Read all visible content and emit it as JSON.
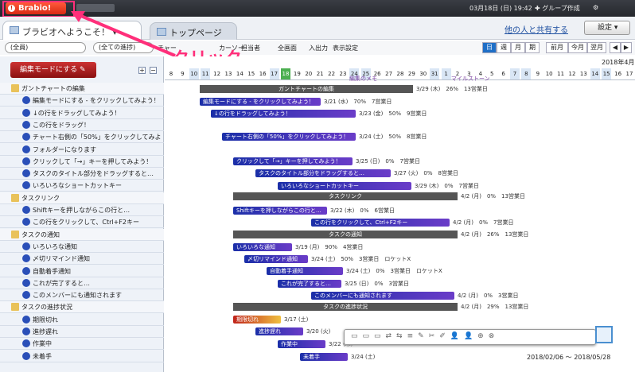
{
  "topbar": {
    "logo": "Brabio!",
    "date": "03月18日 (日) 19:42",
    "group": "グループ作成",
    "gear": "⚙"
  },
  "tabs": {
    "project": "ブラビオへようこそ！",
    "top": "トップページ"
  },
  "share": "他の人と共有する",
  "settings": "設定",
  "filters": {
    "member": "(全員)",
    "progress": "(全ての進捗)"
  },
  "toolbar": [
    "チャー",
    "カーソー",
    "担当者",
    "全画面",
    "入出力",
    "表示設定"
  ],
  "views": [
    "日",
    "週",
    "月",
    "期"
  ],
  "nav": [
    "前月",
    "今月",
    "翌月"
  ],
  "callout": "クリック",
  "edit_button": "編集モードにする",
  "month": "2018年4月",
  "days": [
    "8",
    "9",
    "10",
    "11",
    "12",
    "13",
    "14",
    "15",
    "16",
    "17",
    "18",
    "19",
    "20",
    "21",
    "22",
    "23",
    "24",
    "25",
    "26",
    "27",
    "28",
    "29",
    "30",
    "31",
    "1",
    "2",
    "3",
    "4",
    "5",
    "6",
    "7",
    "8",
    "9",
    "10",
    "11",
    "12",
    "13",
    "14",
    "15",
    "16",
    "17"
  ],
  "tasks": [
    {
      "label": "ガントチャートの編集",
      "parent": true
    },
    {
      "label": "編集モードにする - をクリックしてみよう！"
    },
    {
      "label": "↓の行をドラッグしてみよう！"
    },
    {
      "label": "この行をドラッグ！"
    },
    {
      "label": "チャート右側の「50%」をクリックしてみよ"
    },
    {
      "label": "フォルダーになります"
    },
    {
      "label": "クリックして「→」キーを押してみよう！"
    },
    {
      "label": "タスクのタイトル部分をドラッグすると…"
    },
    {
      "label": "いろいろなショートカットキー"
    },
    {
      "label": "タスクリンク",
      "parent": true
    },
    {
      "label": "Shiftキーを押しながらこの行と…"
    },
    {
      "label": "この行をクリックして、Ctrl+F2キー"
    },
    {
      "label": "タスクの通知",
      "parent": true
    },
    {
      "label": "いろいろな通知"
    },
    {
      "label": "〆切リマインド通知"
    },
    {
      "label": "自動着手通知"
    },
    {
      "label": "これが完了すると…"
    },
    {
      "label": "このメンバーにも通知されます"
    },
    {
      "label": "タスクの進捗状況",
      "parent": true
    },
    {
      "label": "期限切れ"
    },
    {
      "label": "進捗遅れ"
    },
    {
      "label": "作業中"
    },
    {
      "label": "未着手"
    }
  ],
  "chart": {
    "milestones": [
      "編集のメモ",
      "マイルストーン"
    ],
    "groups": [
      {
        "label": "ガントチャートの編集",
        "meta": "3/29 (木)　26%　13営業日"
      },
      {
        "label": "タスクリンク",
        "meta": "4/2 (月)　0%　13営業日"
      },
      {
        "label": "タスクの通知",
        "meta": "4/2 (月)　26%　13営業日"
      },
      {
        "label": "タスクの進捗状況",
        "meta": "4/2 (月)　29%　13営業日"
      }
    ],
    "bars": [
      {
        "label": "編集モードにする - をクリックしてみよう！",
        "meta": "3/21 (水)　70%　7営業日"
      },
      {
        "label": "↓の行をドラッグしてみよう！",
        "meta": "3/23 (金)　50%　9営業日"
      },
      {
        "label": "チャート右側の「50%」をクリックしてみよう！",
        "meta": "3/24 (土)　50%　8営業日"
      },
      {
        "label": "クリックして「→」キーを押してみよう！",
        "meta": "3/25 (日)　0%　7営業日"
      },
      {
        "label": "タスクのタイトル部分をドラッグすると…",
        "meta": "3/27 (火)　0%　8営業日"
      },
      {
        "label": "いろいろなショートカットキー",
        "meta": "3/29 (木)　0%　7営業日"
      },
      {
        "label": "Shiftキーを押しながらこの行と…",
        "meta": "3/22 (木)　0%　6営業日"
      },
      {
        "label": "この行をクリックして、Ctrl+F2キー",
        "meta": "4/2 (月)　0%　7営業日"
      },
      {
        "label": "いろいろな通知",
        "meta": "3/19 (月)　90%　4営業日"
      },
      {
        "label": "〆切リマインド通知",
        "meta": "3/24 (土)　50%　3営業日　ロケットX"
      },
      {
        "label": "自動着手通知",
        "meta": "3/24 (土)　0%　3営業日　ロケットX"
      },
      {
        "label": "これが完了すると…",
        "meta": "3/25 (日)　0%　3営業日"
      },
      {
        "label": "このメンバーにも通知されます",
        "meta": "4/2 (月)　0%　3営業日"
      },
      {
        "label": "期限切れ",
        "meta": "3/17 (土)"
      },
      {
        "label": "進捗遅れ",
        "meta": "3/20 (火)"
      },
      {
        "label": "作業中",
        "meta": "3/22 (木)"
      },
      {
        "label": "未着手",
        "meta": "3/24 (土)"
      }
    ]
  },
  "footer": "2018/02/06 〜 2018/05/28"
}
